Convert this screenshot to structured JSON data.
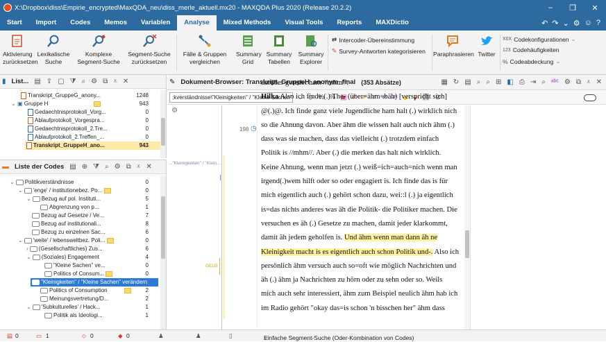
{
  "window": {
    "title": "X:\\Dropbox\\diss\\Empirie_encrypted\\MaxQDA_neu\\diss_merle_aktuell.mx20 - MAXQDA Plus 2020 (Release 20.2.2)",
    "minimize": "–",
    "maximize": "❐",
    "close": "✕"
  },
  "menu": {
    "items": [
      "Start",
      "Import",
      "Codes",
      "Memos",
      "Variablen",
      "Analyse",
      "Mixed Methods",
      "Visual Tools",
      "Reports",
      "MAXDictio"
    ],
    "active": "Analyse",
    "right_icons": [
      "undo-icon",
      "redo-icon",
      "chevron-down-icon",
      "gear-icon",
      "smiley-icon",
      "help-icon"
    ]
  },
  "ribbon": {
    "aktivierung": "Aktivierung\nzurücksetzen",
    "lexikalische": "Lexikalische\nSuche",
    "komplexe": "Komplexe\nSegment-Suche",
    "segment_suche": "Segment-Suche\nzurücksetzen",
    "faelle": "Fälle & Gruppen\nvergleichen",
    "summary_grid": "Summary\nGrid",
    "summary_tabellen": "Summary\nTabellen",
    "summary_explorer": "Summary\nExplorer",
    "intercoder": "Intercoder-Übereinstimmung",
    "survey": "Survey-Antworten kategorisieren",
    "paraphrasieren": "Paraphrasieren",
    "twitter": "Twitter",
    "codekonfig": "Codekonfigurationen",
    "codehaeufigkeiten": "Codehäufigkeiten",
    "codeabdeckung": "Codeabdeckung",
    "codekonfig_prefix": "X0X",
    "codehaeufigkeiten_prefix": "123",
    "codeabdeckung_prefix": "%"
  },
  "doclist": {
    "title": "List...",
    "rows": [
      {
        "label": "Transkript_GruppeG_anony...",
        "count": "1248",
        "indent": 1,
        "type": "doc"
      },
      {
        "label": "Gruppe H",
        "count": "943",
        "indent": 0,
        "type": "group"
      },
      {
        "label": "Gedaechtnisprotokoll_Vorg...",
        "count": "0",
        "indent": 2,
        "type": "text"
      },
      {
        "label": "Ablaufprotokoll_Vorgespra...",
        "count": "0",
        "indent": 2,
        "type": "doc"
      },
      {
        "label": "Gedaechtnisprotokoll_2.Tre...",
        "count": "0",
        "indent": 2,
        "type": "text"
      },
      {
        "label": "Ablaufprotokoll_2.Treffen_...",
        "count": "0",
        "indent": 2,
        "type": "text"
      },
      {
        "label": "Transkript_GruppeH_ano...",
        "count": "943",
        "indent": 2,
        "type": "doc",
        "selected": true
      }
    ]
  },
  "codelist": {
    "title": "Liste der Codes",
    "rows": [
      {
        "label": "Politikverständnisse",
        "count": "0",
        "indent": 0
      },
      {
        "label": "'enge' / institutionebez. Po...",
        "count": "0",
        "indent": 1,
        "memo": true
      },
      {
        "label": "Bezug auf pol. Instituti...",
        "count": "5",
        "indent": 2
      },
      {
        "label": "Abgrenzung von p...",
        "count": "1",
        "indent": 3
      },
      {
        "label": "Bezug auf Gesetze / Ve...",
        "count": "7",
        "indent": 2
      },
      {
        "label": "Bezug auf institutionali...",
        "count": "8",
        "indent": 2
      },
      {
        "label": "Bezug zu einzelnen Sac...",
        "count": "6",
        "indent": 2
      },
      {
        "label": "'weite' / lebensweltbez. Poli...",
        "count": "0",
        "indent": 1,
        "memo": true
      },
      {
        "label": "(Gesellschaftliches) Zus...",
        "count": "6",
        "indent": 2
      },
      {
        "label": "(Soziales) Engagement",
        "count": "4",
        "indent": 2
      },
      {
        "label": "\"Kleine Sachen\" ve...",
        "count": "0",
        "indent": 3
      },
      {
        "label": "Politics of Consum...",
        "count": "0",
        "indent": 3,
        "memo": true
      },
      {
        "label": "\"Kleinigkeiten\" / \"Kleine Sachen\" verändern",
        "count": "6",
        "indent": 2,
        "selected": true
      },
      {
        "label": "Politics of Consumption",
        "count": "2",
        "indent": 2,
        "memo": true
      },
      {
        "label": "Meinungsvertretung/D...",
        "count": "2",
        "indent": 2
      },
      {
        "label": "'Subkulturelles' / Hack...",
        "count": "1",
        "indent": 1
      },
      {
        "label": "Politik als Ideologi...",
        "count": "1",
        "indent": 3
      }
    ]
  },
  "browser": {
    "title": "Dokument-Browser: Transkript_GruppeH_anonym_final",
    "absaetze": "(353 Absätze)",
    "code_field": ";kverständnisse\\\"Kleinigkeiten\" / \"Kleine Sachen\" verändern",
    "margin_label": "...\"Kleinigkeiten\" / \"Klein...",
    "gelb_label": "GELB",
    "para_number": "198",
    "lines": [
      "darüber geredet ham //mhm//.",
      "Hilka Also ich finde (.) The- (über=ähm=bäh) [verspricht sich]",
      "@(.)@. Ich finde ganz viele Jugendliche ham halt (.) wirklich nich",
      "so die Ahnung davon. Aber ähm die wissen halt auch nich ähm (.)",
      "dass was sie machen, dass das vielleicht (.) trotzdem einfach",
      "Politik is //mhm//. Aber (.) die merken das halt nich wirklich.",
      "Keine Ahnung, wenn man jetzt (.) weiß=ich=auch=nich wenn man",
      "irgend(.)wem hilft oder so oder engagiert is. Ich finde das is für",
      "mich eigentlich auch (.) gehört schon dazu, wei::l (.) ja eigentlich",
      "is=das nichts anderes was äh die Politik- die Politiker machen. Die",
      "versuchen es äh (.) Gesetze zu machen, damit jeder klarkommt,",
      "damit äh jedem geholfen is. Und ähm wenn man dann äh ne",
      "Kleinigkeit macht is es eigentlich auch schon Politik und-. Also ich",
      "persönlich ähm versuch auch so=oft wie möglich Nachrichten und",
      "äh (.) ähm ja Nachrichten zu hörn oder zu sehn oder so. Weils",
      "mich auch sehr interessiert, ähm zum Beispiel neulich ähm hab ich",
      "im Radio gehört \"okay das=is schon 'n bisschen her\" ähm dass"
    ]
  },
  "status": {
    "s1": "0",
    "s2": "1",
    "s3": "0",
    "s4": "0",
    "search": "Einfache Segment-Suche (Oder-Kombination von Codes)"
  }
}
